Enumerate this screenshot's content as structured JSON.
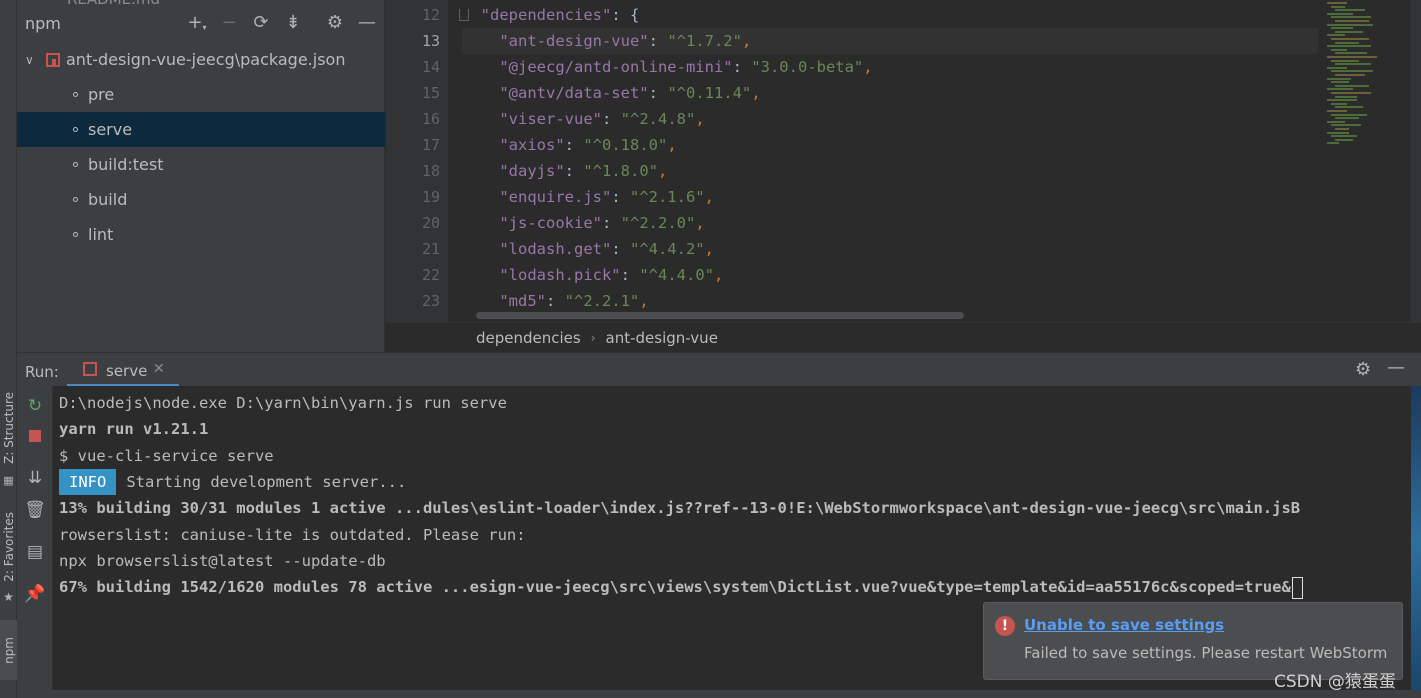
{
  "npm_panel": {
    "title": "npm",
    "ghost_file": "README.md",
    "header_icons": [
      "plus-icon",
      "minus-icon",
      "refresh-icon",
      "collapse-icon",
      "gear-icon",
      "hide-icon"
    ],
    "root_label": "ant-design-vue-jeecg\\package.json",
    "scripts": [
      {
        "label": "pre"
      },
      {
        "label": "serve"
      },
      {
        "label": "build:test"
      },
      {
        "label": "build"
      },
      {
        "label": "lint"
      }
    ],
    "selected_index": 1
  },
  "left_strip": {
    "structure": "Z: Structure",
    "favorites": "2: Favorites",
    "npm": "npm"
  },
  "editor": {
    "current_line": 13,
    "lines": [
      {
        "no": "12",
        "key": "\"dependencies\"",
        "colon": ": ",
        "value": "{",
        "comma": "",
        "indent": "  "
      },
      {
        "no": "13",
        "key": "\"ant-design-vue\"",
        "colon": ": ",
        "value": "\"^1.7.2\"",
        "comma": ",",
        "indent": "    "
      },
      {
        "no": "14",
        "key": "\"@jeecg/antd-online-mini\"",
        "colon": ": ",
        "value": "\"3.0.0-beta\"",
        "comma": ",",
        "indent": "    "
      },
      {
        "no": "15",
        "key": "\"@antv/data-set\"",
        "colon": ": ",
        "value": "\"^0.11.4\"",
        "comma": ",",
        "indent": "    "
      },
      {
        "no": "16",
        "key": "\"viser-vue\"",
        "colon": ": ",
        "value": "\"^2.4.8\"",
        "comma": ",",
        "indent": "    "
      },
      {
        "no": "17",
        "key": "\"axios\"",
        "colon": ": ",
        "value": "\"^0.18.0\"",
        "comma": ",",
        "indent": "    "
      },
      {
        "no": "18",
        "key": "\"dayjs\"",
        "colon": ": ",
        "value": "\"^1.8.0\"",
        "comma": ",",
        "indent": "    "
      },
      {
        "no": "19",
        "key": "\"enquire.js\"",
        "colon": ": ",
        "value": "\"^2.1.6\"",
        "comma": ",",
        "indent": "    "
      },
      {
        "no": "20",
        "key": "\"js-cookie\"",
        "colon": ": ",
        "value": "\"^2.2.0\"",
        "comma": ",",
        "indent": "    "
      },
      {
        "no": "21",
        "key": "\"lodash.get\"",
        "colon": ": ",
        "value": "\"^4.4.2\"",
        "comma": ",",
        "indent": "    "
      },
      {
        "no": "22",
        "key": "\"lodash.pick\"",
        "colon": ": ",
        "value": "\"^4.4.0\"",
        "comma": ",",
        "indent": "    "
      },
      {
        "no": "23",
        "key": "\"md5\"",
        "colon": ": ",
        "value": "\"^2.2.1\"",
        "comma": ",",
        "indent": "    "
      }
    ]
  },
  "breadcrumb": [
    "dependencies",
    "ant-design-vue"
  ],
  "run": {
    "label": "Run:",
    "tab_label": "serve",
    "toolbar_icons": [
      "rerun-icon",
      "stop-icon",
      "scroll-to-end-icon",
      "trash-icon",
      "layout-icon",
      "pin-icon"
    ],
    "console": [
      {
        "text": "D:\\nodejs\\node.exe D:\\yarn\\bin\\yarn.js run serve",
        "bold": false
      },
      {
        "text": "yarn run v1.21.1",
        "bold": true
      },
      {
        "text": "$ vue-cli-service serve",
        "bold": false
      },
      {
        "badge": "INFO",
        "text": "Starting development server...",
        "bold": false
      },
      {
        "text": "13% building 30/31 modules 1 active ...dules\\eslint-loader\\index.js??ref--13-0!E:\\WebStormworkspace\\ant-design-vue-jeecg\\src\\main.jsB",
        "bold": true
      },
      {
        "text": "rowserslist: caniuse-lite is outdated. Please run:",
        "bold": false
      },
      {
        "text": "npx browserslist@latest --update-db",
        "bold": false
      },
      {
        "text": "67% building 1542/1620 modules 78 active ...esign-vue-jeecg\\src\\views\\system\\DictList.vue?vue&type=template&id=aa55176c&scoped=true&",
        "bold": true
      }
    ]
  },
  "notification": {
    "title": "Unable to save settings",
    "body": "Failed to save settings. Please restart WebStorm",
    "icon": "error-icon"
  },
  "watermark": "CSDN @猿蛋蛋",
  "colors": {
    "accent": "#4a88c7",
    "error": "#c75450",
    "json_key": "#9876aa",
    "json_string": "#6a8759",
    "selection": "#0d293e"
  }
}
